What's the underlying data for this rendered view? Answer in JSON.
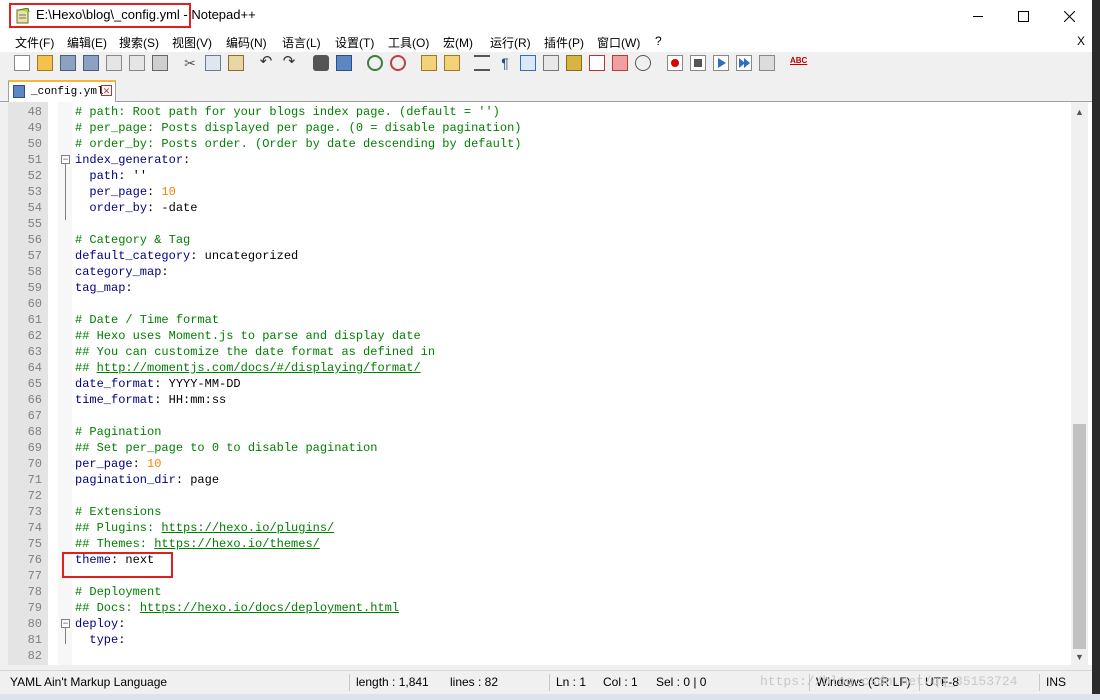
{
  "window": {
    "title": "E:\\Hexo\\blog\\_config.yml - Notepad++",
    "minimize": "—",
    "maximize": "☐",
    "close": "✕"
  },
  "menu": {
    "items": [
      "文件(F)",
      "编辑(E)",
      "搜索(S)",
      "视图(V)",
      "编码(N)",
      "语言(L)",
      "设置(T)",
      "工具(O)",
      "宏(M)",
      "运行(R)",
      "插件(P)",
      "窗口(W)",
      "?"
    ],
    "close_doc": "X"
  },
  "toolbar": {
    "icons": [
      "new-file-icon",
      "open-file-icon",
      "save-icon",
      "save-all-icon",
      "close-icon",
      "close-all-icon",
      "print-icon",
      "cut-icon",
      "copy-icon",
      "paste-icon",
      "undo-icon",
      "redo-icon",
      "find-icon",
      "replace-icon",
      "zoom-in-icon",
      "zoom-out-icon",
      "sync-v-icon",
      "sync-h-icon",
      "word-wrap-icon",
      "show-all-chars-icon",
      "indent-guide-icon",
      "udl-icon",
      "doc-map-icon",
      "function-list-icon",
      "folder-workspace-icon",
      "monitor-icon",
      "record-macro-icon",
      "stop-macro-icon",
      "play-macro-icon",
      "run-macro-multi-icon",
      "save-macro-icon",
      "spell-check-icon"
    ],
    "spell_label": "ABC"
  },
  "tabs": [
    {
      "label": "_config.yml"
    }
  ],
  "editor": {
    "lines": [
      {
        "n": "48",
        "text": "# path: Root path for your blogs index page. (default = '')"
      },
      {
        "n": "49",
        "text": "# per_page: Posts displayed per page. (0 = disable pagination)"
      },
      {
        "n": "50",
        "text": "# order_by: Posts order. (Order by date descending by default)"
      },
      {
        "n": "51",
        "key": "index_generator",
        "sep": ":",
        "val": ""
      },
      {
        "n": "52",
        "key": "path",
        "sep": ": ",
        "val": "''"
      },
      {
        "n": "53",
        "key": "per_page",
        "sep": ": ",
        "num": "10"
      },
      {
        "n": "54",
        "key": "order_by",
        "sep": ": ",
        "val": "-date"
      },
      {
        "n": "55"
      },
      {
        "n": "56",
        "text": "# Category & Tag"
      },
      {
        "n": "57",
        "key": "default_category",
        "sep": ": ",
        "val": "uncategorized"
      },
      {
        "n": "58",
        "key": "category_map",
        "sep": ":",
        "val": ""
      },
      {
        "n": "59",
        "key": "tag_map",
        "sep": ":",
        "val": ""
      },
      {
        "n": "60"
      },
      {
        "n": "61",
        "text": "# Date / Time format"
      },
      {
        "n": "62",
        "text": "## Hexo uses Moment.js to parse and display date"
      },
      {
        "n": "63",
        "text": "## You can customize the date format as defined in"
      },
      {
        "n": "64",
        "text": "## ",
        "link": "http://momentjs.com/docs/#/displaying/format/"
      },
      {
        "n": "65",
        "key": "date_format",
        "sep": ": ",
        "val": "YYYY-MM-DD"
      },
      {
        "n": "66",
        "key": "time_format",
        "sep": ": ",
        "val": "HH:mm:ss"
      },
      {
        "n": "67"
      },
      {
        "n": "68",
        "text": "# Pagination"
      },
      {
        "n": "69",
        "text": "## Set per_page to 0 to disable pagination"
      },
      {
        "n": "70",
        "key": "per_page",
        "sep": ": ",
        "num": "10"
      },
      {
        "n": "71",
        "key": "pagination_dir",
        "sep": ": ",
        "val": "page"
      },
      {
        "n": "72"
      },
      {
        "n": "73",
        "text": "# Extensions"
      },
      {
        "n": "74",
        "text": "## Plugins: ",
        "link": "https://hexo.io/plugins/"
      },
      {
        "n": "75",
        "text": "## Themes: ",
        "link": "https://hexo.io/themes/"
      },
      {
        "n": "76",
        "key": "theme",
        "sep": ": ",
        "val": "next"
      },
      {
        "n": "77"
      },
      {
        "n": "78",
        "text": "# Deployment"
      },
      {
        "n": "79",
        "text": "## Docs: ",
        "link": "https://hexo.io/docs/deployment.html"
      },
      {
        "n": "80",
        "key": "deploy",
        "sep": ":",
        "val": ""
      },
      {
        "n": "81",
        "key": "type",
        "sep": ":",
        "val": ""
      },
      {
        "n": "82"
      }
    ]
  },
  "status": {
    "language": "YAML Ain't Markup Language",
    "length": "length : 1,841",
    "lines": "lines : 82",
    "ln": "Ln : 1",
    "col": "Col : 1",
    "sel": "Sel : 0 | 0",
    "eol": "Windows (CR LF)",
    "encoding": "UTF-8",
    "mode": "INS"
  },
  "watermark": "https://blog.csdn.net/qq_35153724",
  "colors": {
    "comment": "#008000",
    "keyword": "#000080",
    "number": "#ff8000",
    "annotation": "#e01f1f"
  }
}
